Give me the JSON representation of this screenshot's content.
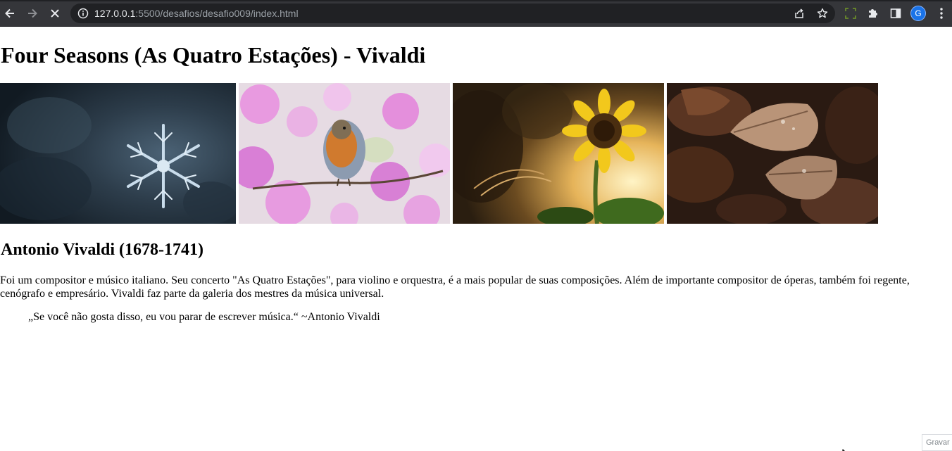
{
  "browser": {
    "url_host": "127.0.0.1",
    "url_path": ":5500/desafios/desafio009/index.html",
    "profile_initial": "G",
    "icons": [
      "back-arrow-icon",
      "forward-arrow-icon",
      "stop-loading-icon",
      "site-info-icon",
      "share-icon",
      "bookmark-star-icon",
      "screen-capture-icon",
      "extensions-puzzle-icon",
      "side-panel-icon",
      "kebab-menu-icon"
    ],
    "accent": "#1a73e8"
  },
  "page": {
    "title": "Four Seasons (As Quatro Estações) - Vivaldi",
    "gallery": [
      {
        "subject": "snowflake-photo"
      },
      {
        "subject": "robin-on-blossoms-photo"
      },
      {
        "subject": "sunflower-photo"
      },
      {
        "subject": "autumn-leaves-photo"
      }
    ],
    "subtitle": "Antonio Vivaldi (1678-1741)",
    "bio": "Foi um compositor e músico italiano. Seu concerto \"As Quatro Estações\", para violino e orquestra, é a mais popular de suas composições. Além de importante compositor de óperas, também foi regente, cenógrafo e empresário. Vivaldi faz parte da galeria dos mestres da música universal.",
    "quote": "„Se você não gosta disso, eu vou parar de escrever música.“ ~Antonio Vivaldi"
  },
  "overlay": {
    "record_label": "Gravar"
  }
}
